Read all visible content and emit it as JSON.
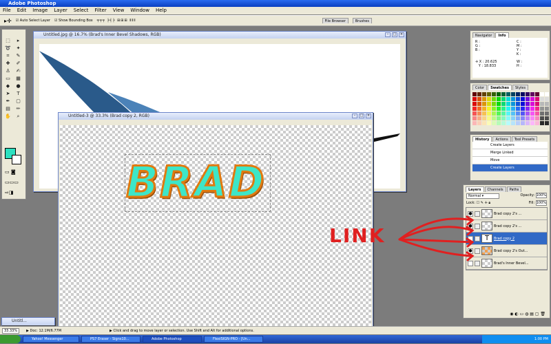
{
  "app": {
    "title": "Adobe Photoshop"
  },
  "menu": [
    "File",
    "Edit",
    "Image",
    "Layer",
    "Select",
    "Filter",
    "View",
    "Window",
    "Help"
  ],
  "options": {
    "auto_select": "Auto Select Layer",
    "bounding": "Show Bounding Box",
    "file_browser": "File Browser",
    "brushes": "Brushes"
  },
  "doc1": {
    "title": "Untitled.jpg @ 16.7% (Brad's Inner Bevel Shadows, RGB)"
  },
  "doc2": {
    "title": "Untitled-3 @ 33.3% (Brad copy 2, RGB)",
    "text": "BRAD"
  },
  "navigator": {
    "tab1": "Navigator",
    "tab2": "Info",
    "r": "R :",
    "g": "G :",
    "b": "B :",
    "c": "C :",
    "m": "M :",
    "y": "Y :",
    "k": "K :",
    "x": "X :",
    "y2": "Y :",
    "xv": "20.625",
    "yv": "18.833",
    "w": "W :",
    "h": "H :"
  },
  "swatches": {
    "tab1": "Color",
    "tab2": "Swatches",
    "tab3": "Styles"
  },
  "history": {
    "tab1": "History",
    "tab2": "Actions",
    "tab3": "Tool Presets",
    "items": [
      "Create Layers",
      "Merge Linked",
      "Move",
      "Create Layers"
    ]
  },
  "layers": {
    "tab1": "Layers",
    "tab2": "Channels",
    "tab3": "Paths",
    "mode": "Normal",
    "opacity_label": "Opacity:",
    "opacity": "100%",
    "lock_label": "Lock:",
    "fill_label": "Fill:",
    "fill": "100%",
    "rows": [
      "Brad copy 2's ...",
      "Brad copy 2's ...",
      "Brad copy 2",
      "Brad copy 2's Out...",
      "Brad's Inner Bevel..."
    ]
  },
  "annotation": {
    "text": "LINK"
  },
  "minimized": {
    "title": "Untitl..."
  },
  "status": {
    "zoom": "33.33%",
    "doc": "Doc: 12.1M/6.77M",
    "hint": "Click and drag to move layer or selection.  Use Shift and Alt for additional options."
  },
  "taskbar": {
    "start": "",
    "items": [
      "Yahoo! Messenger",
      "PS7 Eraser - Signs10...",
      "Adobe Photoshop",
      "FlexiSIGN-PRO - [Un..."
    ],
    "clock": "1:00 PM"
  },
  "colors": {
    "accent": "#2a6cf0",
    "foreground": "#2de0c0",
    "annotation": "#e02020"
  }
}
